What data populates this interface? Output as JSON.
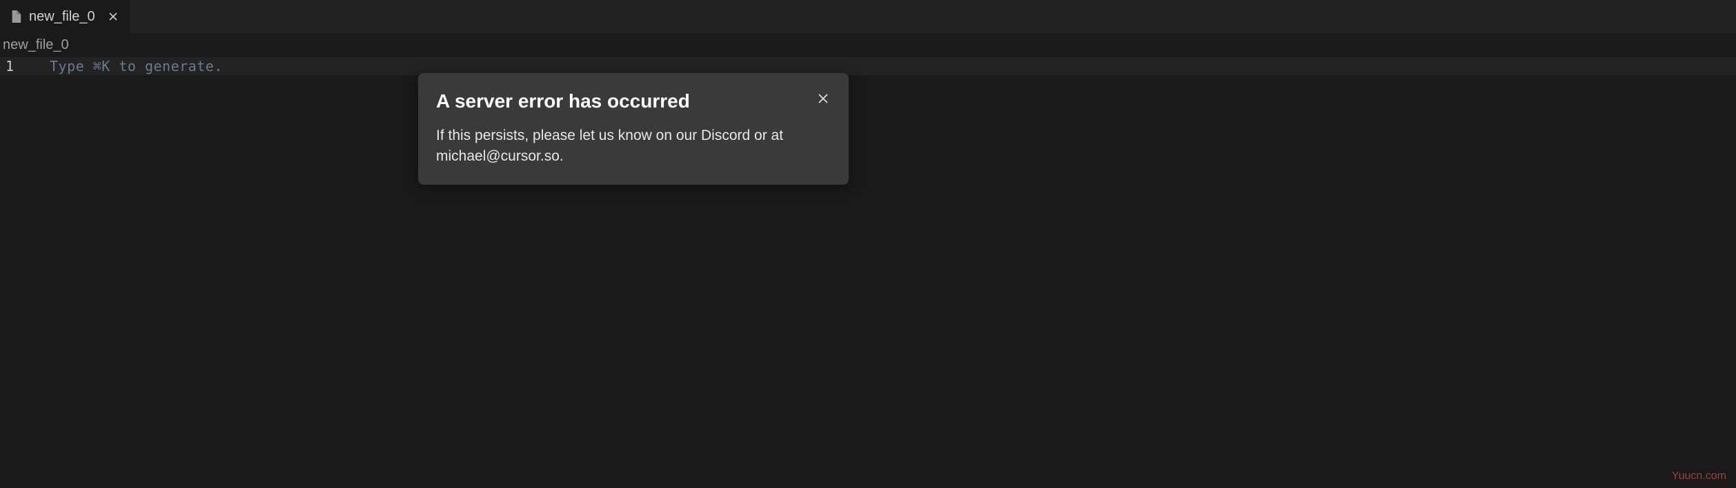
{
  "tab": {
    "label": "new_file_0"
  },
  "breadcrumb": {
    "path": "new_file_0"
  },
  "editor": {
    "line_number": "1",
    "placeholder": "Type ⌘K to generate."
  },
  "dialog": {
    "title": "A server error has occurred",
    "body": "If this persists, please let us know on our Discord or at michael@cursor.so."
  },
  "watermark": "Yuucn.com"
}
